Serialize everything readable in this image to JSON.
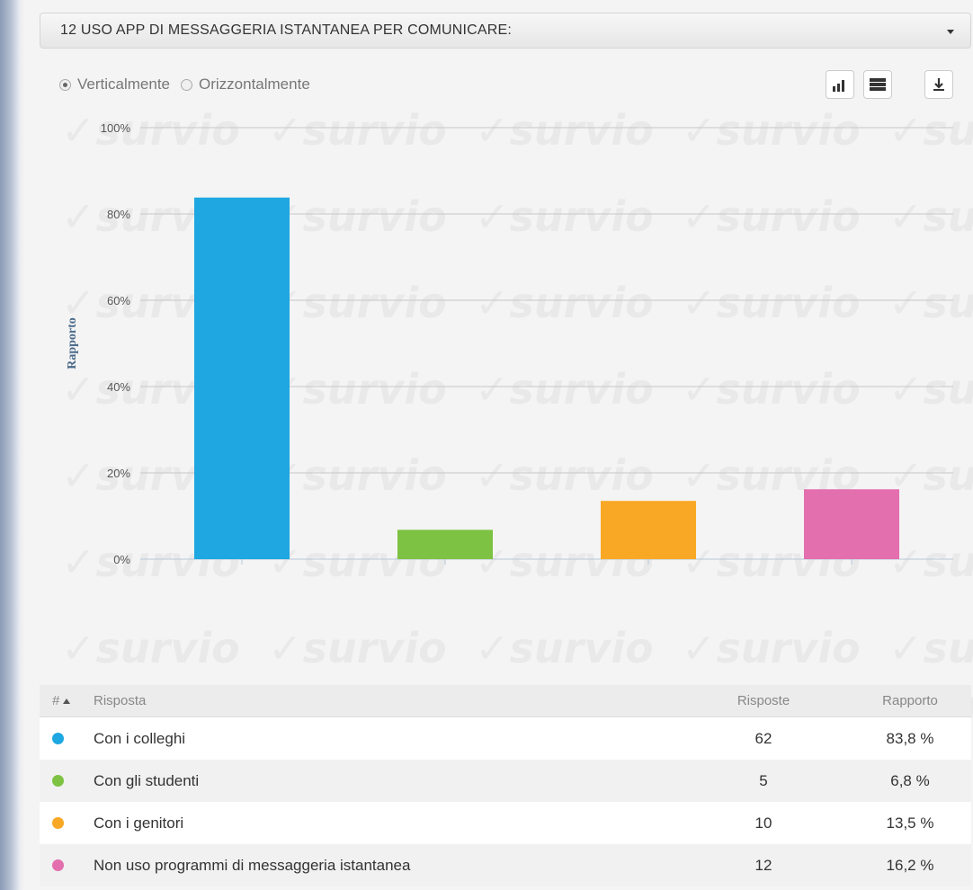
{
  "header": {
    "title": "12 USO APP DI MESSAGGERIA ISTANTANEA PER COMUNICARE:"
  },
  "orientation": {
    "vertical_label": "Verticalmente",
    "horizontal_label": "Orizzontalmente",
    "selected": "vertical"
  },
  "watermark": {
    "text": "✓survio"
  },
  "table": {
    "columns": [
      "#",
      "Risposta",
      "Risposte",
      "Rapporto"
    ],
    "rows": [
      {
        "label": "Con i colleghi",
        "count": "62",
        "pct": "83,8 %",
        "color": "#1ea7e1"
      },
      {
        "label": "Con gli studenti",
        "count": "5",
        "pct": "6,8 %",
        "color": "#7dc242"
      },
      {
        "label": "Con i genitori",
        "count": "10",
        "pct": "13,5 %",
        "color": "#f9a825"
      },
      {
        "label": "Non uso programmi di messaggeria istantanea",
        "count": "12",
        "pct": "16,2 %",
        "color": "#e36fae"
      }
    ]
  },
  "chart_data": {
    "type": "bar",
    "categories": [
      "Con i colleghi",
      "Con gli studenti",
      "Con i genitori",
      "Non uso programmi di messaggeria istantanea"
    ],
    "values": [
      83.8,
      6.8,
      13.5,
      16.2
    ],
    "colors": [
      "#1ea7e1",
      "#7dc242",
      "#f9a825",
      "#e36fae"
    ],
    "ylabel": "Rapporto",
    "ylim": [
      0,
      100
    ],
    "yticks": [
      "0%",
      "20%",
      "40%",
      "60%",
      "80%",
      "100%"
    ],
    "ytick_values": [
      0,
      20,
      40,
      60,
      80,
      100
    ],
    "grid": true
  }
}
